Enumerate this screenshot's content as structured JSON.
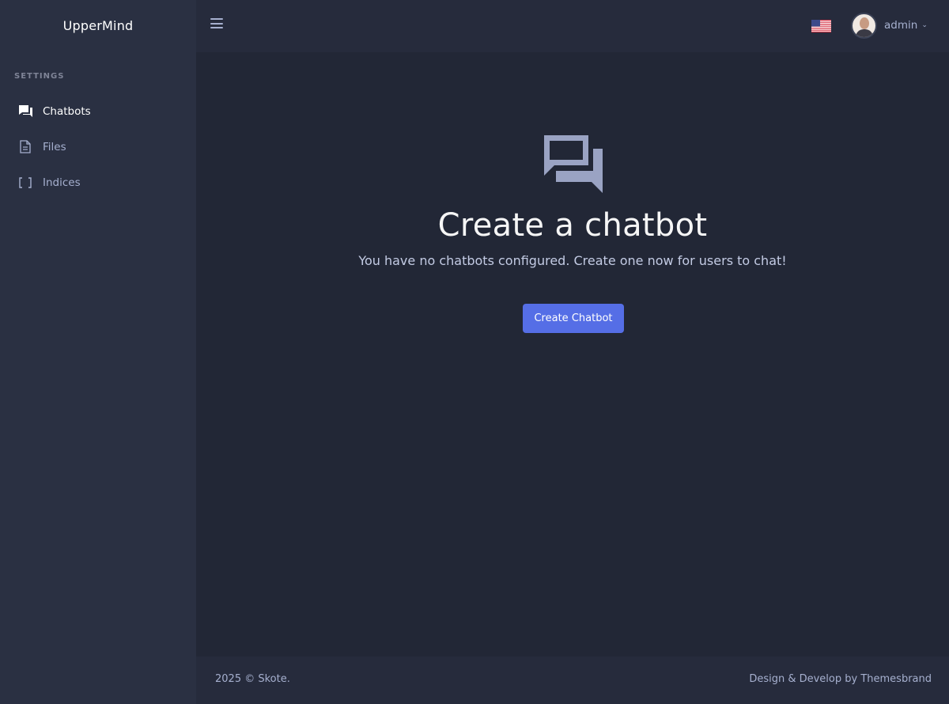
{
  "app": {
    "brand": "UpperMind"
  },
  "sidebar": {
    "section_title": "SETTINGS",
    "items": [
      {
        "label": "Chatbots",
        "icon": "chat-bubbles-icon",
        "active": true
      },
      {
        "label": "Files",
        "icon": "file-icon",
        "active": false
      },
      {
        "label": "Indices",
        "icon": "brackets-icon",
        "active": false
      }
    ]
  },
  "topbar": {
    "menu_icon": "hamburger-icon",
    "language_flag": "us-flag-icon",
    "user": {
      "name": "admin",
      "avatar": "avatar",
      "dropdown_icon": "chevron-down-icon"
    }
  },
  "empty_state": {
    "icon": "chat-bubbles-icon",
    "title": "Create a chatbot",
    "description": "You have no chatbots configured. Create one now for users to chat!",
    "button_label": "Create Chatbot"
  },
  "footer": {
    "left": "2025 © Skote.",
    "right": "Design & Develop by Themesbrand"
  },
  "colors": {
    "sidebar_bg": "#2a3042",
    "topbar_bg": "#262b3c",
    "main_bg": "#222736",
    "accent": "#556ee6",
    "muted_text": "#a6b0cf"
  }
}
